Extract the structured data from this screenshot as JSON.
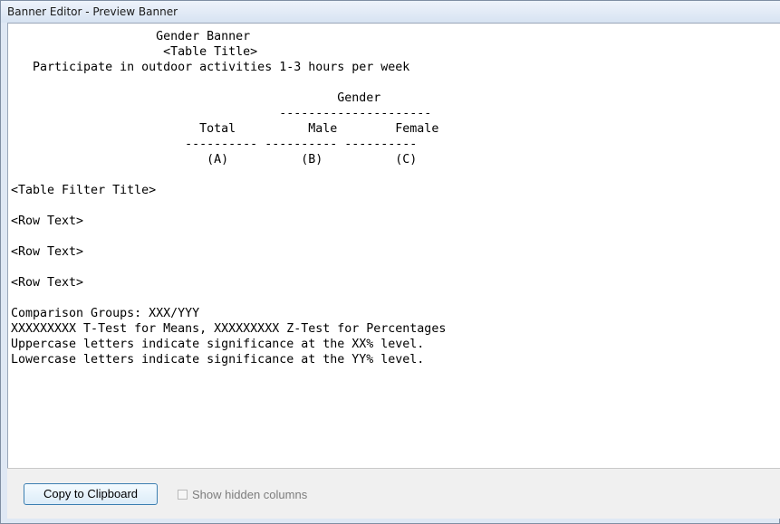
{
  "window": {
    "title": "Banner Editor - Preview Banner"
  },
  "preview": {
    "lines": [
      "                    Gender Banner",
      "                     <Table Title>",
      "   Participate in outdoor activities 1-3 hours per week",
      "",
      "                                             Gender",
      "                                     ---------------------",
      "                          Total          Male        Female",
      "                        ---------- ---------- ----------",
      "                           (A)          (B)          (C)",
      "",
      "<Table Filter Title>",
      "",
      "<Row Text>",
      "",
      "<Row Text>",
      "",
      "<Row Text>",
      "",
      "Comparison Groups: XXX/YYY",
      "XXXXXXXXX T-Test for Means, XXXXXXXXX Z-Test for Percentages",
      "Uppercase letters indicate significance at the XX% level.",
      "Lowercase letters indicate significance at the YY% level."
    ]
  },
  "footer": {
    "copy_button_label": "Copy to Clipboard",
    "show_hidden_label": "Show hidden columns",
    "show_hidden_checked": false
  }
}
